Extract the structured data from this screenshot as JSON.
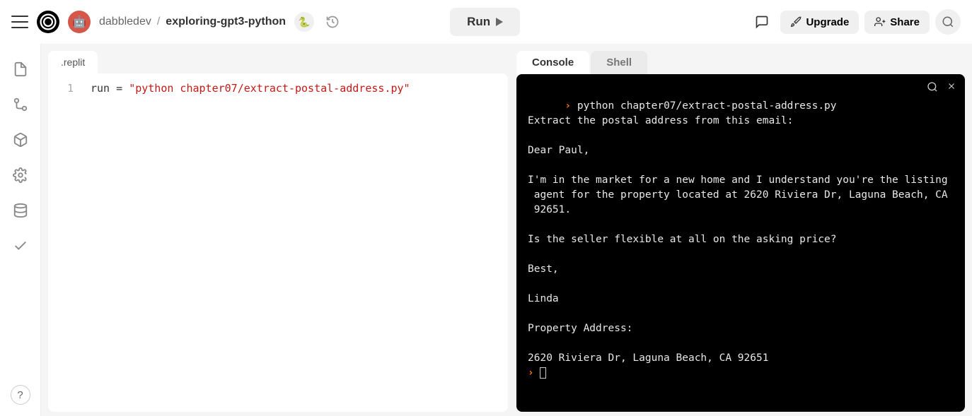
{
  "header": {
    "user": "dabbledev",
    "sep": "/",
    "project": "exploring-gpt3-python",
    "lang_badge": "🐍",
    "run_label": "Run",
    "upgrade_label": "Upgrade",
    "share_label": "Share"
  },
  "editor": {
    "file_tab": ".replit",
    "line_number": "1",
    "code_var": "run",
    "code_op": " = ",
    "code_str": "\"python chapter07/extract-postal-address.py\""
  },
  "console": {
    "tabs": {
      "console": "Console",
      "shell": "Shell"
    },
    "prompt_symbol": "›",
    "command": "python chapter07/extract-postal-address.py",
    "output": "Extract the postal address from this email:\n\nDear Paul,\n\nI'm in the market for a new home and I understand you're the listing\n agent for the property located at 2620 Riviera Dr, Laguna Beach, CA\n 92651.\n\nIs the seller flexible at all on the asking price?\n\nBest,\n\nLinda\n\nProperty Address:\n\n2620 Riviera Dr, Laguna Beach, CA 92651"
  },
  "help": "?"
}
